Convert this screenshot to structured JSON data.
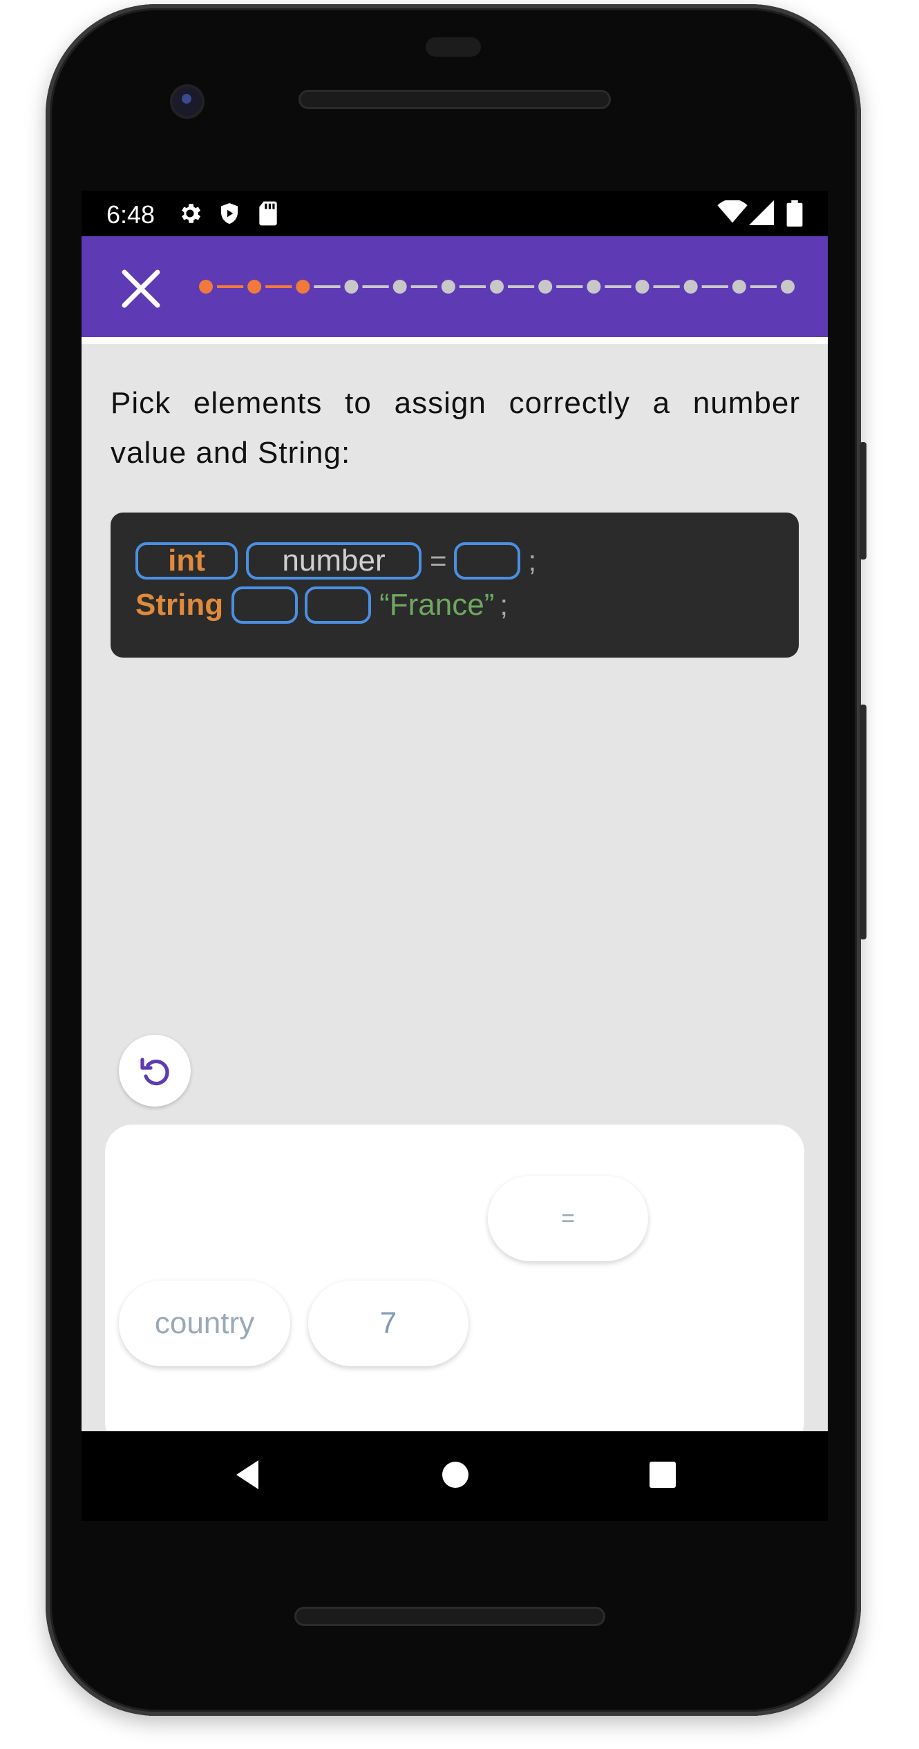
{
  "status_bar": {
    "time": "6:48"
  },
  "progress": {
    "total_steps": 13,
    "completed_steps": 3,
    "active_color": "#f07a3c",
    "inactive_color": "#c8c8c8"
  },
  "question": {
    "text": "Pick elements to assign correctly a number value and String:"
  },
  "code": {
    "line1": {
      "type_keyword": "int",
      "variable": "number",
      "operator": "=",
      "terminator": ";"
    },
    "line2": {
      "type_keyword": "String",
      "value": "“France”",
      "terminator": ";"
    }
  },
  "choices": [
    {
      "label": "="
    },
    {
      "label": "country"
    },
    {
      "label": "7"
    }
  ],
  "colors": {
    "app_bar": "#5e3ab5",
    "slot_border": "#4a90e2",
    "keyword": "#e08a3c",
    "string": "#6ea860"
  }
}
